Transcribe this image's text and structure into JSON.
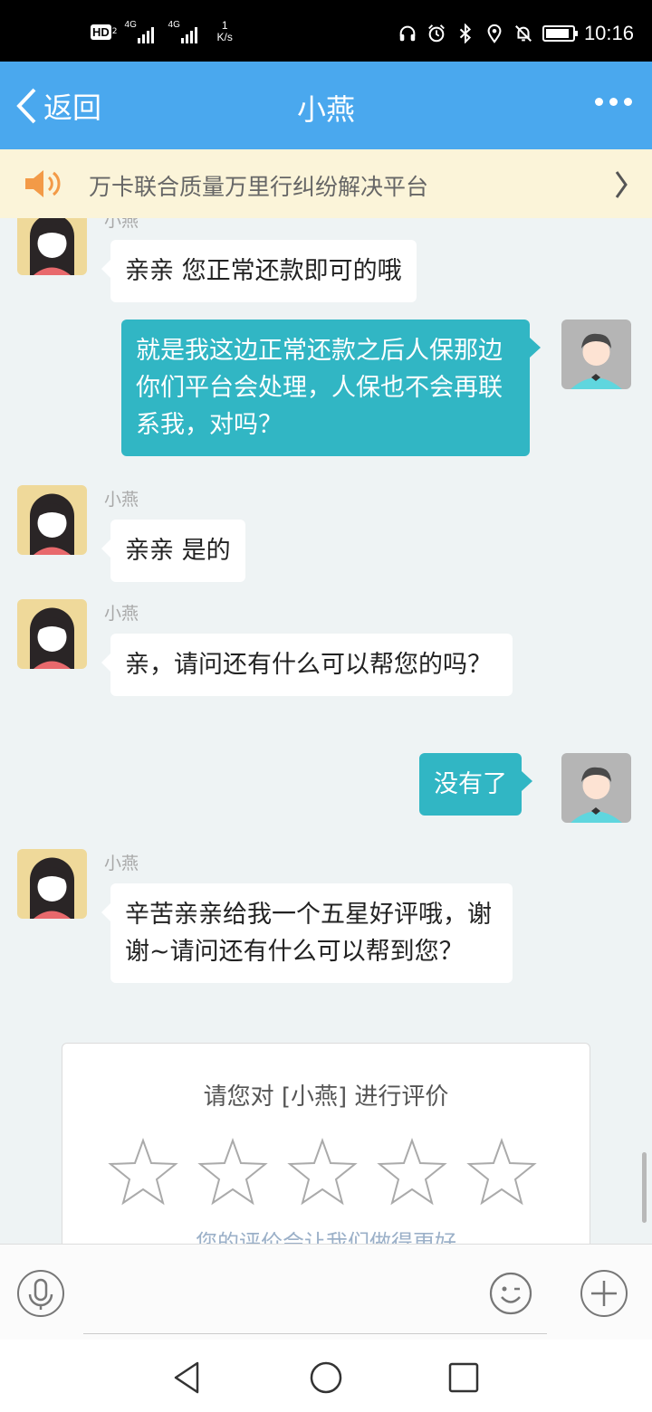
{
  "status_bar": {
    "hd_label": "HD",
    "hd_sub": "2",
    "signal1_gen": "4G",
    "signal2_gen": "4G",
    "speed_value": "1",
    "speed_unit": "K/s",
    "time": "10:16",
    "battery_level_percent": 90
  },
  "nav": {
    "back_label": "返回",
    "title": "小燕"
  },
  "notice": {
    "text": "万卡联合质量万里行纠纷解决平台"
  },
  "messages": [
    {
      "side": "left",
      "sender": "小燕",
      "text": "亲亲 您正常还款即可的哦"
    },
    {
      "side": "right",
      "text": "就是我这边正常还款之后人保那边你们平台会处理，人保也不会再联系我，对吗？"
    },
    {
      "side": "left",
      "sender": "小燕",
      "text": "亲亲 是的"
    },
    {
      "side": "left",
      "sender": "小燕",
      "text": "亲，请问还有什么可以帮您的吗？"
    },
    {
      "side": "right",
      "text": "没有了"
    },
    {
      "side": "left",
      "sender": "小燕",
      "text": "辛苦亲亲给我一个五星好评哦，谢谢~请问还有什么可以帮到您？"
    }
  ],
  "rating": {
    "title": "请您对 [小燕] 进行评价",
    "stars_total": 5,
    "stars_selected": 0,
    "hint": "您的评价会让我们做得更好"
  },
  "colors": {
    "nav_bg": "#4aa8ee",
    "sent_bubble": "#31b6c4",
    "notice_bg": "#fbf4d9"
  },
  "icons": [
    "headset-icon",
    "alarm-icon",
    "bluetooth-icon",
    "location-icon",
    "mute-icon",
    "speaker-icon",
    "chevron-right-icon",
    "microphone-icon",
    "emoji-icon",
    "plus-icon",
    "back-triangle-icon",
    "home-circle-icon",
    "recents-square-icon"
  ]
}
